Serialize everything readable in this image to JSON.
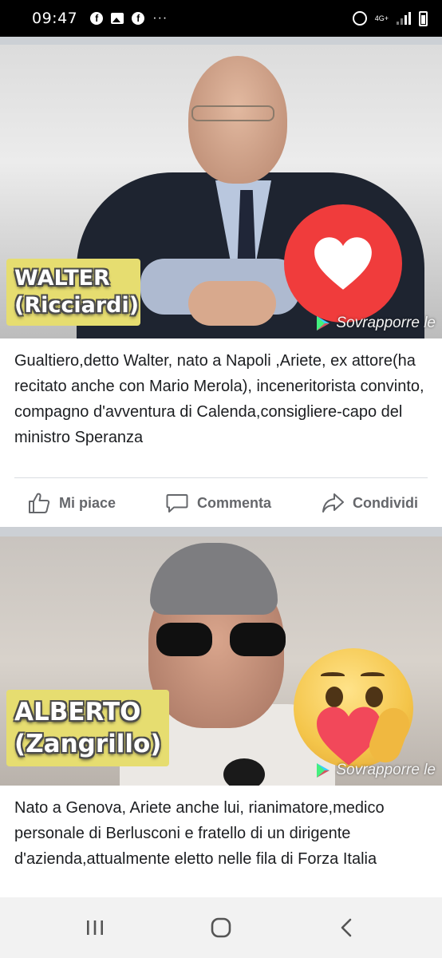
{
  "status_bar": {
    "time": "09:47",
    "network": "4G+",
    "left_icons": [
      "facebook-icon",
      "gallery-icon",
      "facebook-icon",
      "more-dots-icon"
    ],
    "right_icons": [
      "alarm-icon",
      "network-4g-icon",
      "signal-icon",
      "battery-icon"
    ]
  },
  "posts": [
    {
      "name_line1": "WALTER",
      "name_line2": "(Ricciardi)",
      "reaction": "love-reaction",
      "watermark": "Sovrapporre le",
      "text": "Gualtiero,detto Walter, nato a Napoli ,Ariete, ex attore(ha recitato anche con Mario Merola), inceneritorista convinto, compagno d'avventura di Calenda,consigliere-capo del ministro Speranza",
      "actions": {
        "like": "Mi piace",
        "comment": "Commenta",
        "share": "Condividi"
      }
    },
    {
      "name_line1": "ALBERTO",
      "name_line2": "(Zangrillo)",
      "reaction": "care-reaction",
      "watermark": "Sovrapporre le",
      "text": "Nato a Genova, Ariete anche lui, rianimatore,medico personale di Berlusconi e fratello di un dirigente d'azienda,attualmente eletto nelle fila di Forza Italia"
    }
  ],
  "nav_bar": {
    "icons": [
      "recent-apps-icon",
      "home-icon",
      "back-icon"
    ]
  },
  "colors": {
    "status_bg": "#000000",
    "feed_gap": "#ccd0d5",
    "action_text": "#65676b",
    "name_tag_bg": "#e6dd70",
    "love_red": "#f03c3c",
    "care_yellow": "#f4c54a"
  }
}
